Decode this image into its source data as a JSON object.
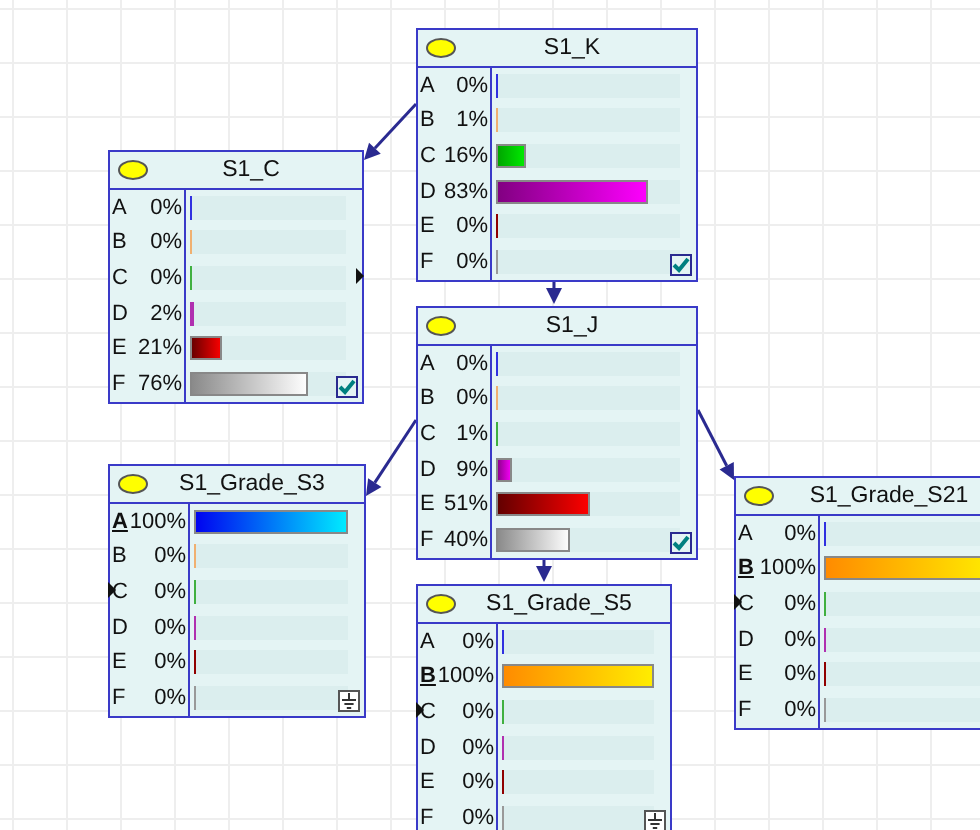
{
  "nodes": [
    {
      "title": "S1_K",
      "kind": "free",
      "left_port": false,
      "right_port": false,
      "states": [
        {
          "label": "A",
          "value": "0%",
          "level": 0,
          "observed": false
        },
        {
          "label": "B",
          "value": "1%",
          "level": 0.01,
          "observed": false
        },
        {
          "label": "C",
          "value": "16%",
          "level": 0.16,
          "observed": false
        },
        {
          "label": "D",
          "value": "83%",
          "level": 0.83,
          "observed": false
        },
        {
          "label": "E",
          "value": "0%",
          "level": 0,
          "observed": false
        },
        {
          "label": "F",
          "value": "0%",
          "level": 0,
          "observed": false
        }
      ]
    },
    {
      "title": "S1_C",
      "kind": "free",
      "left_port": false,
      "right_port": true,
      "states": [
        {
          "label": "A",
          "value": "0%",
          "level": 0,
          "observed": false
        },
        {
          "label": "B",
          "value": "0%",
          "level": 0,
          "observed": false
        },
        {
          "label": "C",
          "value": "0%",
          "level": 0,
          "observed": false
        },
        {
          "label": "D",
          "value": "2%",
          "level": 0.02,
          "observed": false
        },
        {
          "label": "E",
          "value": "21%",
          "level": 0.21,
          "observed": false
        },
        {
          "label": "F",
          "value": "76%",
          "level": 0.76,
          "observed": false
        }
      ]
    },
    {
      "title": "S1_J",
      "kind": "free",
      "left_port": false,
      "right_port": false,
      "states": [
        {
          "label": "A",
          "value": "0%",
          "level": 0,
          "observed": false
        },
        {
          "label": "B",
          "value": "0%",
          "level": 0,
          "observed": false
        },
        {
          "label": "C",
          "value": "1%",
          "level": 0.01,
          "observed": false
        },
        {
          "label": "D",
          "value": "9%",
          "level": 0.09,
          "observed": false
        },
        {
          "label": "E",
          "value": "51%",
          "level": 0.51,
          "observed": false
        },
        {
          "label": "F",
          "value": "40%",
          "level": 0.4,
          "observed": false
        }
      ]
    },
    {
      "title": "S1_Grade_S3",
      "kind": "evidence",
      "left_port": true,
      "right_port": false,
      "states": [
        {
          "label": "A",
          "value": "100%",
          "level": 1,
          "observed": true
        },
        {
          "label": "B",
          "value": "0%",
          "level": 0,
          "observed": false
        },
        {
          "label": "C",
          "value": "0%",
          "level": 0,
          "observed": false
        },
        {
          "label": "D",
          "value": "0%",
          "level": 0,
          "observed": false
        },
        {
          "label": "E",
          "value": "0%",
          "level": 0,
          "observed": false
        },
        {
          "label": "F",
          "value": "0%",
          "level": 0,
          "observed": false
        }
      ]
    },
    {
      "title": "S1_Grade_S5",
      "kind": "evidence",
      "left_port": true,
      "right_port": false,
      "states": [
        {
          "label": "A",
          "value": "0%",
          "level": 0,
          "observed": false
        },
        {
          "label": "B",
          "value": "100%",
          "level": 1,
          "observed": true
        },
        {
          "label": "C",
          "value": "0%",
          "level": 0,
          "observed": false
        },
        {
          "label": "D",
          "value": "0%",
          "level": 0,
          "observed": false
        },
        {
          "label": "E",
          "value": "0%",
          "level": 0,
          "observed": false
        },
        {
          "label": "F",
          "value": "0%",
          "level": 0,
          "observed": false
        }
      ]
    },
    {
      "title": "S1_Grade_S21",
      "kind": "evidence",
      "left_port": true,
      "right_port": false,
      "states": [
        {
          "label": "A",
          "value": "0%",
          "level": 0,
          "observed": false
        },
        {
          "label": "B",
          "value": "100%",
          "level": 1,
          "observed": true
        },
        {
          "label": "C",
          "value": "0%",
          "level": 0,
          "observed": false
        },
        {
          "label": "D",
          "value": "0%",
          "level": 0,
          "observed": false
        },
        {
          "label": "E",
          "value": "0%",
          "level": 0,
          "observed": false
        },
        {
          "label": "F",
          "value": "0%",
          "level": 0,
          "observed": false
        }
      ]
    }
  ]
}
